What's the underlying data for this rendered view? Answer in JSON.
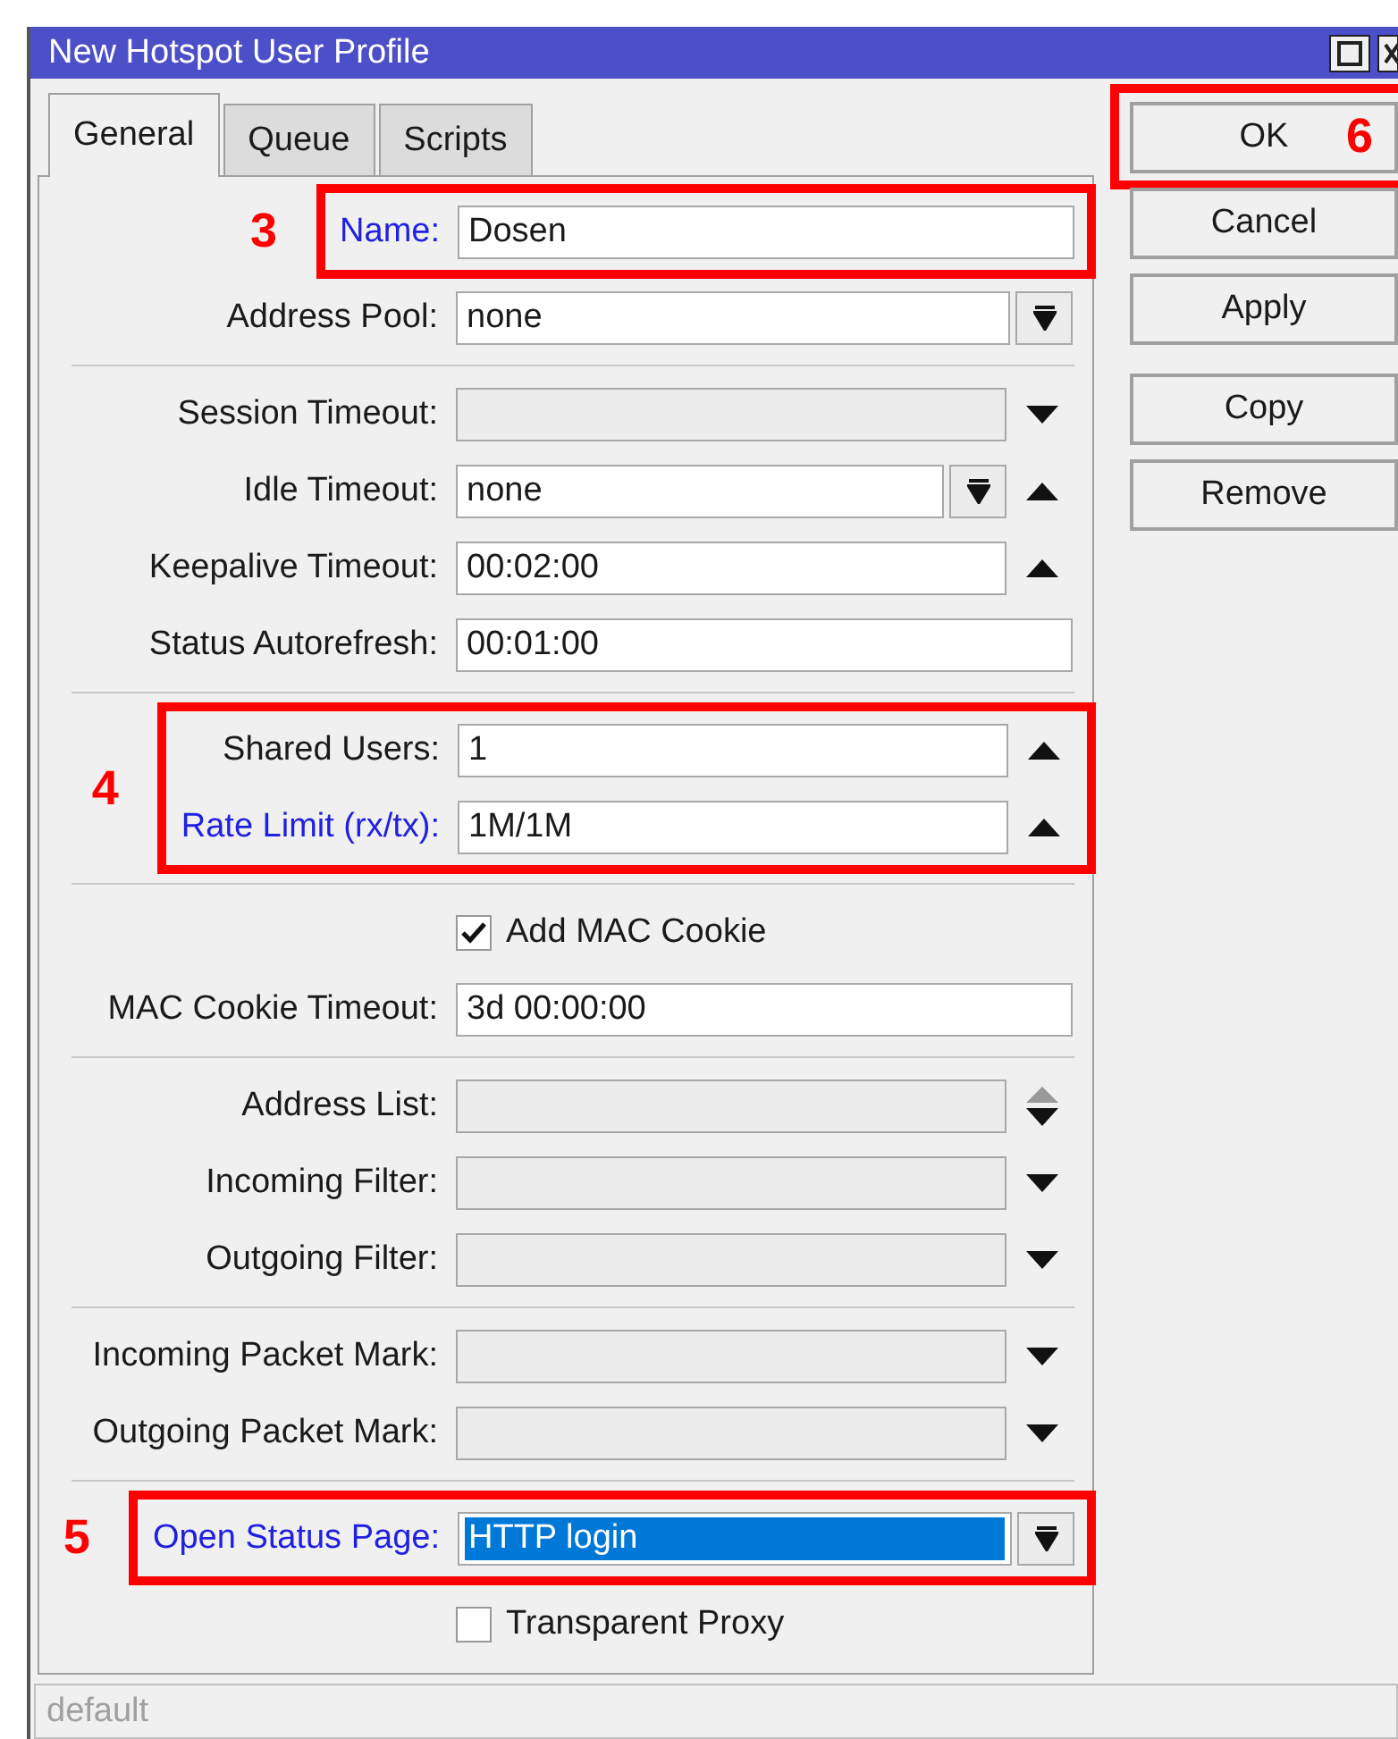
{
  "window": {
    "title": "New Hotspot User Profile"
  },
  "tabs": [
    {
      "label": "General",
      "selected": true
    },
    {
      "label": "Queue",
      "selected": false
    },
    {
      "label": "Scripts",
      "selected": false
    }
  ],
  "sections": [
    {
      "rows": [
        {
          "kind": "annotated",
          "annotation": "3",
          "rows": [
            {
              "kind": "field",
              "label": "Name:",
              "highlighted": true,
              "value": "Dosen",
              "selected": false,
              "dropdown": false
            }
          ]
        },
        {
          "kind": "field",
          "label": "Address Pool:",
          "highlighted": false,
          "value": "none",
          "selected": false,
          "dropdown": true
        }
      ]
    },
    {
      "rows": [
        {
          "kind": "field",
          "label": "Session Timeout:",
          "highlighted": false,
          "dropdown": false,
          "side": {
            "kind": "down"
          }
        },
        {
          "kind": "field",
          "label": "Idle Timeout:",
          "highlighted": false,
          "value": "none",
          "selected": false,
          "dropdown": true,
          "side": {
            "kind": "up"
          }
        },
        {
          "kind": "field",
          "label": "Keepalive Timeout:",
          "highlighted": false,
          "value": "00:02:00",
          "selected": false,
          "dropdown": false,
          "side": {
            "kind": "up"
          }
        },
        {
          "kind": "field",
          "label": "Status Autorefresh:",
          "highlighted": false,
          "value": "00:01:00",
          "selected": false,
          "dropdown": false
        }
      ]
    },
    {
      "rows": [
        {
          "kind": "annotated",
          "annotation": "4",
          "rows": [
            {
              "kind": "field",
              "label": "Shared Users:",
              "highlighted": false,
              "value": "1",
              "selected": false,
              "dropdown": false,
              "side": {
                "kind": "up"
              }
            },
            {
              "kind": "field",
              "label": "Rate Limit (rx/tx):",
              "highlighted": true,
              "value": "1M/1M",
              "selected": false,
              "dropdown": false,
              "side": {
                "kind": "up"
              }
            }
          ]
        }
      ]
    },
    {
      "rows": [
        {
          "kind": "checkbox",
          "label": "Add MAC Cookie",
          "checked": true
        },
        {
          "kind": "field",
          "label": "MAC Cookie Timeout:",
          "highlighted": false,
          "value": "3d 00:00:00",
          "selected": false,
          "dropdown": false
        }
      ]
    },
    {
      "rows": [
        {
          "kind": "field",
          "label": "Address List:",
          "highlighted": false,
          "dropdown": false,
          "side": {
            "kind": "updown"
          }
        },
        {
          "kind": "field",
          "label": "Incoming Filter:",
          "highlighted": false,
          "dropdown": false,
          "side": {
            "kind": "down"
          }
        },
        {
          "kind": "field",
          "label": "Outgoing Filter:",
          "highlighted": false,
          "dropdown": false,
          "side": {
            "kind": "down"
          }
        }
      ]
    },
    {
      "rows": [
        {
          "kind": "field",
          "label": "Incoming Packet Mark:",
          "highlighted": false,
          "dropdown": false,
          "side": {
            "kind": "down"
          }
        },
        {
          "kind": "field",
          "label": "Outgoing Packet Mark:",
          "highlighted": false,
          "dropdown": false,
          "side": {
            "kind": "down"
          }
        }
      ]
    },
    {
      "rows": [
        {
          "kind": "annotated",
          "annotation": "5",
          "rows": [
            {
              "kind": "field",
              "label": "Open Status Page:",
              "highlighted": true,
              "value": "HTTP login",
              "selected": true,
              "dropdown": true
            }
          ]
        },
        {
          "kind": "checkbox",
          "label": "Transparent Proxy",
          "checked": false
        }
      ]
    }
  ],
  "button_groups": [
    [
      {
        "label": "OK",
        "annotation": "6"
      },
      {
        "label": "Cancel"
      },
      {
        "label": "Apply"
      }
    ],
    [
      {
        "label": "Copy"
      },
      {
        "label": "Remove"
      }
    ]
  ],
  "status_bar": "default"
}
